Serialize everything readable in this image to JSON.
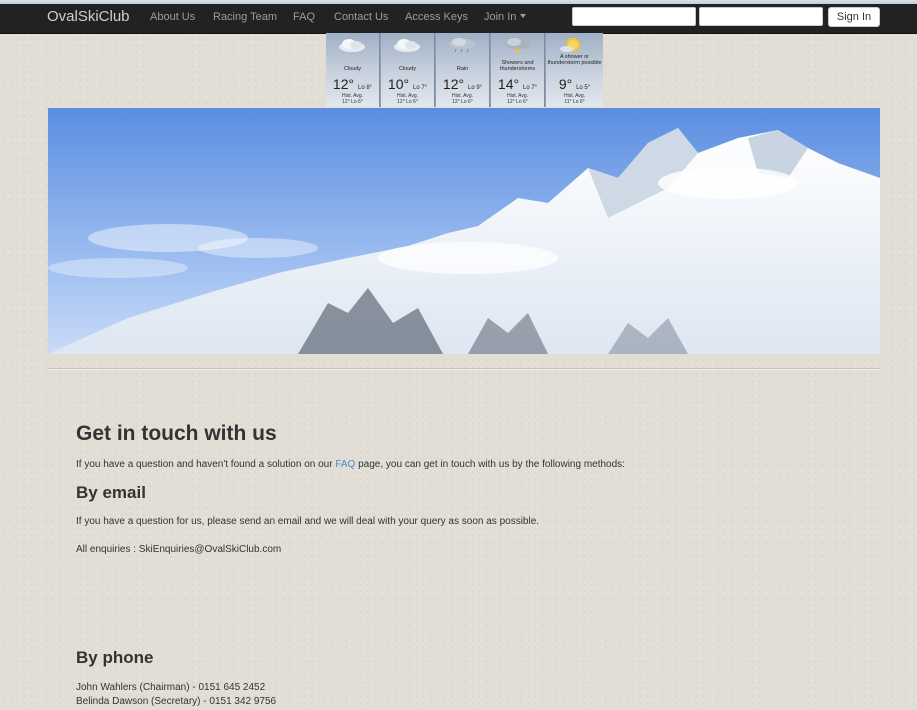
{
  "navbar": {
    "brand": "OvalSkiClub",
    "links": [
      "About Us",
      "Racing Team",
      "FAQ",
      "Contact Us",
      "Access Keys",
      "Join In"
    ],
    "username_value": "",
    "password_value": "",
    "signin_label": "Sign In"
  },
  "weather": [
    {
      "condition": "Cloudy",
      "high": "12°",
      "low": "Lo 8°",
      "hist": "Hist. Avg.",
      "hist_vals": "12° Lo 6°",
      "icon": "cloud-icon"
    },
    {
      "condition": "Cloudy",
      "high": "10°",
      "low": "Lo 7°",
      "hist": "Hist. Avg.",
      "hist_vals": "12° Lo 6°",
      "icon": "cloud-icon"
    },
    {
      "condition": "Rain",
      "high": "12°",
      "low": "Lo 9°",
      "hist": "Hist. Avg.",
      "hist_vals": "12° Lo 6°",
      "icon": "rain-cloud-icon"
    },
    {
      "condition": "Showers and thunderstorms",
      "high": "14°",
      "low": "Lo 7°",
      "hist": "Hist. Avg.",
      "hist_vals": "12° Lo 6°",
      "icon": "storm-cloud-icon"
    },
    {
      "condition": "A shower or thunderstorm possible",
      "high": "9°",
      "low": "Lo 5°",
      "hist": "Hist. Avg.",
      "hist_vals": "11° Lo 6°",
      "icon": "sun-storm-icon"
    }
  ],
  "content": {
    "title": "Get in touch with us",
    "intro_before": "If you have a question and haven't found a solution on our ",
    "intro_link": "FAQ",
    "intro_after": " page, you can get in touch with us by the following methods:",
    "email_heading": "By email",
    "email_text": "If you have a question for us, please send an email and we will deal with your query as soon as possible.",
    "email_contact": "All enquiries : SkiEnquiries@OvalSkiClub.com",
    "phone_heading": "By phone",
    "phone_1": "John Wahlers (Chairman) - 0151 645 2452",
    "phone_2": "Belinda Dawson (Secretary) - 0151 342 9756"
  },
  "colors": {
    "navbar": "#222222",
    "link": "#428bca",
    "background": "#e3ded5"
  }
}
